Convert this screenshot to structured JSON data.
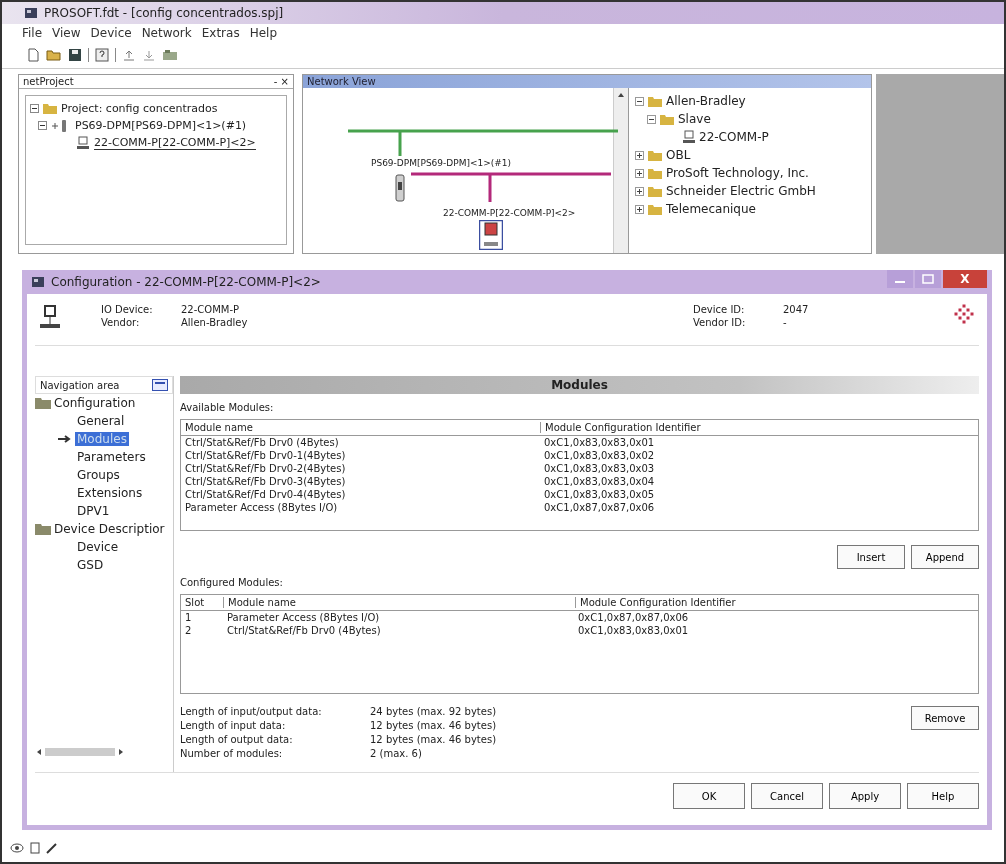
{
  "window": {
    "title": "PROSOFT.fdt - [config concentrados.spj]"
  },
  "menu": [
    "File",
    "View",
    "Device",
    "Network",
    "Extras",
    "Help"
  ],
  "net_project": {
    "title": "netProject",
    "close": "- ×",
    "tree": [
      {
        "label": "Project: config concentrados",
        "expanded": true,
        "children": [
          {
            "label": "PS69-DPM[PS69-DPM]<1>(#1)",
            "expanded": true,
            "children": [
              {
                "label": "22-COMM-P[22-COMM-P]<2>",
                "selected": true
              }
            ]
          }
        ]
      }
    ]
  },
  "network_view": {
    "title": "Network View",
    "master_label": "PS69-DPM[PS69-DPM]<1>(#1)",
    "slave_label": "22-COMM-P[22-COMM-P]<2>"
  },
  "catalog": [
    {
      "label": "Allen-Bradley",
      "expanded": true,
      "children": [
        {
          "label": "Slave",
          "expanded": true,
          "children": [
            {
              "label": "22-COMM-P",
              "kind": "device"
            }
          ]
        }
      ]
    },
    {
      "label": "OBL",
      "expanded": false
    },
    {
      "label": "ProSoft Technology, Inc.",
      "expanded": false
    },
    {
      "label": "Schneider Electric GmbH",
      "expanded": false
    },
    {
      "label": "Telemecanique",
      "expanded": false
    }
  ],
  "dialog": {
    "title": "Configuration - 22-COMM-P[22-COMM-P]<2>",
    "close": "X",
    "info": [
      {
        "label": "IO Device:",
        "value": "22-COMM-P"
      },
      {
        "label": "Vendor:",
        "value": "Allen-Bradley"
      },
      {
        "label": "Device ID:",
        "value": "2047"
      },
      {
        "label": "Vendor ID:",
        "value": "-"
      }
    ],
    "nav_title": "Navigation area",
    "nav": [
      {
        "label": "Configuration",
        "children": [
          {
            "label": "General",
            "selected": false
          },
          {
            "label": "Modules",
            "selected": true
          },
          {
            "label": "Parameters",
            "selected": false
          },
          {
            "label": "Groups",
            "selected": false
          },
          {
            "label": "Extensions",
            "selected": false
          },
          {
            "label": "DPV1",
            "selected": false
          }
        ]
      },
      {
        "label": "Device Descriptior",
        "children": [
          {
            "label": "Device",
            "selected": false
          },
          {
            "label": "GSD",
            "selected": false
          }
        ]
      }
    ],
    "section_title": "Modules",
    "available": {
      "label": "Available Modules:",
      "columns": [
        "Module name",
        "Module Configuration Identifier"
      ],
      "rows": [
        [
          "Ctrl/Stat&Ref/Fb Drv0  (4Bytes)",
          "0xC1,0x83,0x83,0x01"
        ],
        [
          "Ctrl/Stat&Ref/Fb Drv0-1(4Bytes)",
          "0xC1,0x83,0x83,0x02"
        ],
        [
          "Ctrl/Stat&Ref/Fb Drv0-2(4Bytes)",
          "0xC1,0x83,0x83,0x03"
        ],
        [
          "Ctrl/Stat&Ref/Fb Drv0-3(4Bytes)",
          "0xC1,0x83,0x83,0x04"
        ],
        [
          "Ctrl/Stat&Ref/Fd Drv0-4(4Bytes)",
          "0xC1,0x83,0x83,0x05"
        ],
        [
          "Parameter Access  (8Bytes I/O)",
          "0xC1,0x87,0x87,0x06"
        ]
      ]
    },
    "insert_buttons": [
      "Insert",
      "Append"
    ],
    "configured": {
      "label": "Configured Modules:",
      "columns": [
        "Slot",
        "Module name",
        "Module Configuration Identifier"
      ],
      "rows": [
        [
          "1",
          "Parameter Access  (8Bytes I/O)",
          "0xC1,0x87,0x87,0x06"
        ],
        [
          "2",
          "Ctrl/Stat&Ref/Fb Drv0  (4Bytes)",
          "0xC1,0x83,0x83,0x01"
        ]
      ]
    },
    "summary": [
      {
        "label": "Length of input/output data:",
        "value": "24 bytes (max. 92 bytes)"
      },
      {
        "label": "Length of input data:",
        "value": "12 bytes (max. 46 bytes)"
      },
      {
        "label": "Length of output data:",
        "value": "12 bytes (max. 46 bytes)"
      },
      {
        "label": "Number of modules:",
        "value": "2 (max. 6)"
      }
    ],
    "remove_button": "Remove",
    "buttons": [
      "OK",
      "Cancel",
      "Apply",
      "Help"
    ]
  }
}
